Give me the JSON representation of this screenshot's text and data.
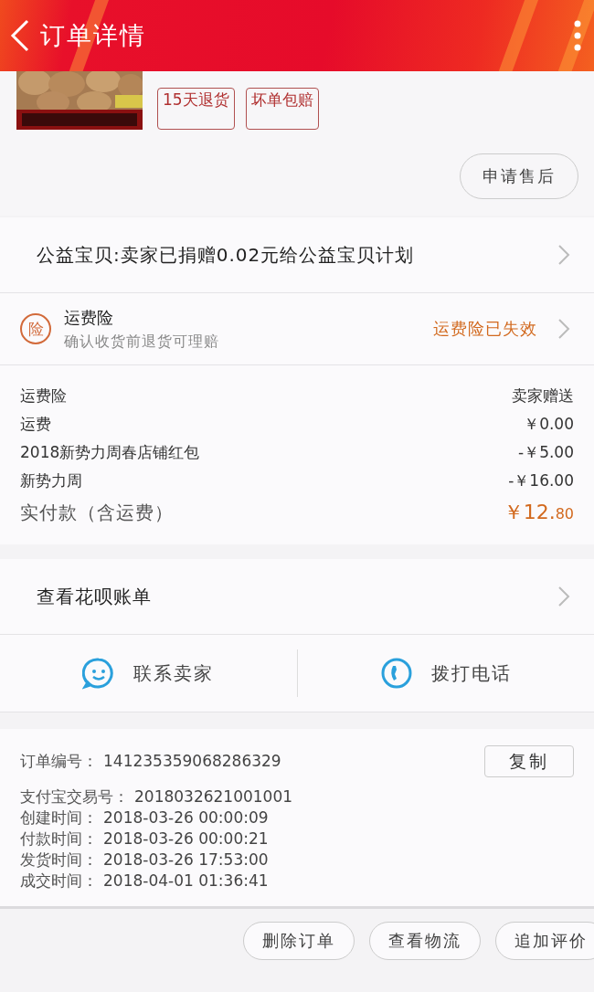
{
  "header": {
    "title": "订单详情"
  },
  "product": {
    "image": {
      "kind": "picture"
    },
    "tags": [
      "15天退货",
      "坏单包赔"
    ],
    "after_sale_button": "申请售后"
  },
  "charity": {
    "text": "公益宝贝:卖家已捐赠0.02元给公益宝贝计划"
  },
  "insurance": {
    "badge": "险",
    "title": "运费险",
    "subtitle": "确认收货前退货可理赔",
    "status": "运费险已失效"
  },
  "fees": [
    {
      "label": "运费险",
      "value": "卖家赠送"
    },
    {
      "label": "运费",
      "value": "￥0.00"
    },
    {
      "label": "2018新势力周春店铺红包",
      "value": "-￥5.00"
    },
    {
      "label": "新势力周",
      "value": "-￥16.00"
    }
  ],
  "total": {
    "label": "实付款（含运费）",
    "amount": "￥12.80"
  },
  "huabei": {
    "text": "查看花呗账单"
  },
  "contact": [
    {
      "kind": "chat",
      "label": "联系卖家"
    },
    {
      "kind": "phone",
      "label": "拨打电话"
    }
  ],
  "order_info": {
    "copy_button": "复制",
    "rows": [
      {
        "label": "订单编号：",
        "value": "141235359068286329"
      },
      {
        "label": "支付宝交易号：",
        "value": "2018032621001001"
      },
      {
        "label": "创建时间：",
        "value": "2018-03-26 00:00:09"
      },
      {
        "label": "付款时间：",
        "value": "2018-03-26 00:00:21"
      },
      {
        "label": "发货时间：",
        "value": "2018-03-26 17:53:00"
      },
      {
        "label": "成交时间：",
        "value": "2018-04-01 01:36:41"
      }
    ]
  },
  "actions": [
    "删除订单",
    "查看物流",
    "追加评价"
  ]
}
